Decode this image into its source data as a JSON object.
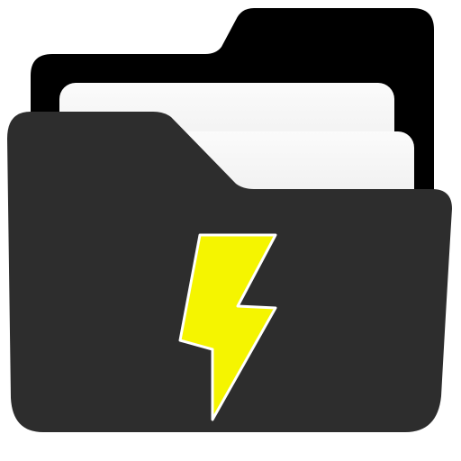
{
  "app_icon": {
    "icon_name": "file-manager-folder-icon",
    "colors": {
      "background": "#ffffff",
      "folder_back": "#000000",
      "folder_front": "#2d2d2d",
      "paper_light": "#f5f5f5",
      "paper_shade": "#cfcfcf",
      "bolt": "#f5f500",
      "bolt_outline": "#ffffff"
    }
  }
}
